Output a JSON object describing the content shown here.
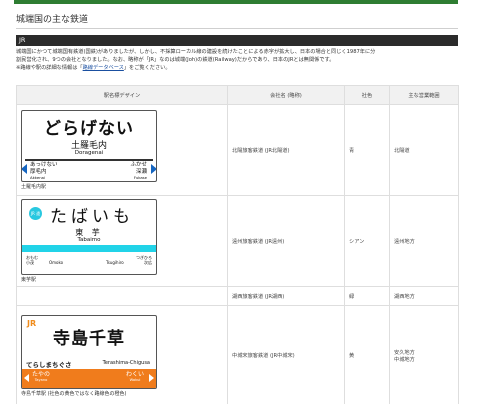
{
  "page": {
    "title": "城端国の主な鉄道",
    "section": "JR",
    "intro_line1": "城端国にかつて城端国有鉄道(国鉄)がありましたが、しかし、不採算ローカル線の建設を続けたことによる赤字が拡大し、日本の場合と同じく1987年に分",
    "intro_line2": "割民営化され、9つの会社となりました。なお、略称が「JR」なのは城端(Joh)の鉄道(Railway)だからであり、日本のJRとは無関係です。",
    "intro_line3_pre": "※路線や駅の詳細な情報は「",
    "intro_link": "路線データベース",
    "intro_line3_post": "」をご覧ください。"
  },
  "table": {
    "headers": [
      "駅名標デザイン",
      "会社名 (略称)",
      "社色",
      "主な営業範囲"
    ],
    "rows": [
      {
        "company": "北陽旅客鉄道 (JR北陽道)",
        "color": "青",
        "area": "北陽道",
        "caption": "土羅毛内駅",
        "sign": {
          "main": "どらげない",
          "kanji": "土羅毛内",
          "roman": "Doragenai",
          "left_kana": "あっけない",
          "left_kanji": "厚毛内",
          "left_roman": "Akkenai",
          "right_kana": "ふかせ",
          "right_kanji": "深瀬",
          "right_roman": "Fukase"
        }
      },
      {
        "company": "遠州旅客鉄道 (JR遠州)",
        "color": "シアン",
        "area": "遠州地方",
        "caption": "東芋駅",
        "sign": {
          "badge": "JR 遠州",
          "main": "たばいも",
          "kanji": "東 芋",
          "roman": "Tabaimo",
          "left_kana": "おもむ",
          "left_kanji": "小茂",
          "left_roman": "Omoko",
          "mid_roman": "Tsugihiro",
          "right_kana": "つぎひろ",
          "right_kanji": "次広"
        }
      },
      {
        "company": "湖西旅客鉄道 (JR湖西)",
        "color": "緑",
        "area": "湖西地方"
      },
      {
        "company": "中城宋旅客鉄道 (JR中城宋)",
        "color": "黄",
        "area_line1": "安久地方",
        "area_line2": "中城地方",
        "caption": "寺島千草駅 (社色の黄色ではなく路線色の橙色)",
        "sign": {
          "jr": "JR",
          "main": "寺島千草",
          "kana": "てらしまちぐさ",
          "roman": "Terashima-Chigusa",
          "left_kana": "たやの",
          "left_roman": "Tayano",
          "right_kana": "わくい",
          "right_roman": "Wakui"
        }
      }
    ]
  },
  "colors": {
    "top_accent": "#2e7d32",
    "section_bar": "#2b2b2b",
    "link": "#1a4fa0",
    "sign_blue_arrow": "#1565c0",
    "sign_cyan": "#21d3e8",
    "sign_orange": "#f07c1c"
  }
}
